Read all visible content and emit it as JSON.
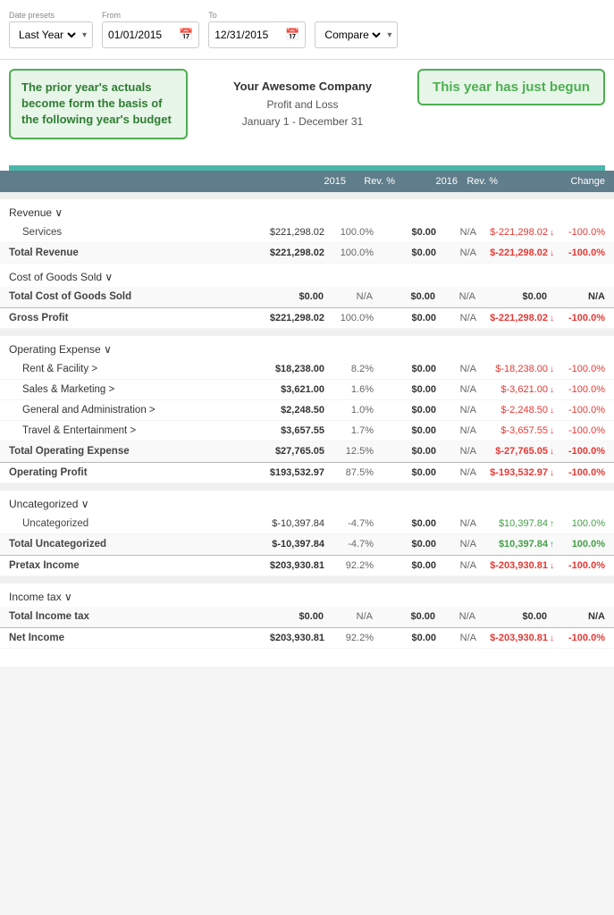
{
  "toolbar": {
    "date_presets_label": "Date presets",
    "from_label": "From",
    "to_label": "To",
    "preset_value": "Last Year",
    "from_date": "01/01/2015",
    "to_date": "12/31/2015",
    "compare_label": "Compare"
  },
  "annotation": {
    "left_text": "The prior year's actuals become form the basis of the following year's budget",
    "company_name": "Your Awesome Company",
    "report_title": "Profit and Loss",
    "date_range": "January 1 - December 31",
    "right_text": "This year has just begun"
  },
  "table_header": {
    "col1": "2015",
    "col2": "Rev. %",
    "col3": "2016",
    "col4": "Rev. %",
    "col5": "Change"
  },
  "sections": [
    {
      "name": "revenue",
      "header": "Revenue ∨",
      "rows": [
        {
          "name": "Services",
          "indent": false,
          "bold": false,
          "v2015": "$221,298.02",
          "rev2015": "100.0%",
          "v2016": "$0.00",
          "rev2016": "N/A",
          "change": "$-221,298.02",
          "change_dir": "down",
          "pct": "-100.0%"
        },
        {
          "name": "Total Revenue",
          "indent": false,
          "bold": true,
          "v2015": "$221,298.02",
          "rev2015": "100.0%",
          "v2016": "$0.00",
          "rev2016": "N/A",
          "change": "$-221,298.02",
          "change_dir": "down",
          "pct": "-100.0%"
        }
      ]
    },
    {
      "name": "cogs",
      "header": "Cost of Goods Sold ∨",
      "rows": [
        {
          "name": "Total Cost of Goods Sold",
          "indent": false,
          "bold": true,
          "v2015": "$0.00",
          "rev2015": "N/A",
          "v2016": "$0.00",
          "rev2016": "N/A",
          "change": "$0.00",
          "change_dir": "none",
          "pct": "N/A"
        },
        {
          "name": "Gross Profit",
          "indent": false,
          "bold": true,
          "gross": true,
          "v2015": "$221,298.02",
          "rev2015": "100.0%",
          "v2016": "$0.00",
          "rev2016": "N/A",
          "change": "$-221,298.02",
          "change_dir": "down",
          "pct": "-100.0%"
        }
      ]
    },
    {
      "name": "operating",
      "header": "Operating Expense ∨",
      "rows": [
        {
          "name": "Rent & Facility >",
          "indent": false,
          "bold": false,
          "link": true,
          "v2015": "$18,238.00",
          "rev2015": "8.2%",
          "v2016": "$0.00",
          "rev2016": "N/A",
          "change": "$-18,238.00",
          "change_dir": "down",
          "pct": "-100.0%"
        },
        {
          "name": "Sales & Marketing >",
          "indent": false,
          "bold": false,
          "link": true,
          "v2015": "$3,621.00",
          "rev2015": "1.6%",
          "v2016": "$0.00",
          "rev2016": "N/A",
          "change": "$-3,621.00",
          "change_dir": "down",
          "pct": "-100.0%"
        },
        {
          "name": "General and Administration >",
          "indent": false,
          "bold": false,
          "link": true,
          "v2015": "$2,248.50",
          "rev2015": "1.0%",
          "v2016": "$0.00",
          "rev2016": "N/A",
          "change": "$-2,248.50",
          "change_dir": "down",
          "pct": "-100.0%"
        },
        {
          "name": "Travel & Entertainment >",
          "indent": false,
          "bold": false,
          "link": true,
          "v2015": "$3,657.55",
          "rev2015": "1.7%",
          "v2016": "$0.00",
          "rev2016": "N/A",
          "change": "$-3,657.55",
          "change_dir": "down",
          "pct": "-100.0%"
        },
        {
          "name": "Total Operating Expense",
          "indent": false,
          "bold": true,
          "v2015": "$27,765.05",
          "rev2015": "12.5%",
          "v2016": "$0.00",
          "rev2016": "N/A",
          "change": "$-27,765.05",
          "change_dir": "down",
          "pct": "-100.0%"
        },
        {
          "name": "Operating Profit",
          "indent": false,
          "bold": true,
          "v2015": "$193,532.97",
          "rev2015": "87.5%",
          "v2016": "$0.00",
          "rev2016": "N/A",
          "change": "$-193,532.97",
          "change_dir": "down",
          "pct": "-100.0%"
        }
      ]
    },
    {
      "name": "uncategorized",
      "header": "Uncategorized ∨",
      "rows": [
        {
          "name": "Uncategorized",
          "indent": false,
          "bold": false,
          "v2015": "$-10,397.84",
          "rev2015": "-4.7%",
          "v2016": "$0.00",
          "rev2016": "N/A",
          "change": "$10,397.84",
          "change_dir": "up",
          "pct": "100.0%"
        },
        {
          "name": "Total Uncategorized",
          "indent": false,
          "bold": true,
          "v2015": "$-10,397.84",
          "rev2015": "-4.7%",
          "v2016": "$0.00",
          "rev2016": "N/A",
          "change": "$10,397.84",
          "change_dir": "up",
          "pct": "100.0%"
        },
        {
          "name": "Pretax Income",
          "indent": false,
          "bold": true,
          "v2015": "$203,930.81",
          "rev2015": "92.2%",
          "v2016": "$0.00",
          "rev2016": "N/A",
          "change": "$-203,930.81",
          "change_dir": "down",
          "pct": "-100.0%"
        }
      ]
    },
    {
      "name": "income_tax",
      "header": "Income tax ∨",
      "rows": [
        {
          "name": "Total Income tax",
          "indent": false,
          "bold": true,
          "v2015": "$0.00",
          "rev2015": "N/A",
          "v2016": "$0.00",
          "rev2016": "N/A",
          "change": "$0.00",
          "change_dir": "none",
          "pct": "N/A"
        },
        {
          "name": "Net Income",
          "indent": false,
          "bold": true,
          "v2015": "$203,930.81",
          "rev2015": "92.2%",
          "v2016": "$0.00",
          "rev2016": "N/A",
          "change": "$-203,930.81",
          "change_dir": "down",
          "pct": "-100.0%"
        }
      ]
    }
  ]
}
